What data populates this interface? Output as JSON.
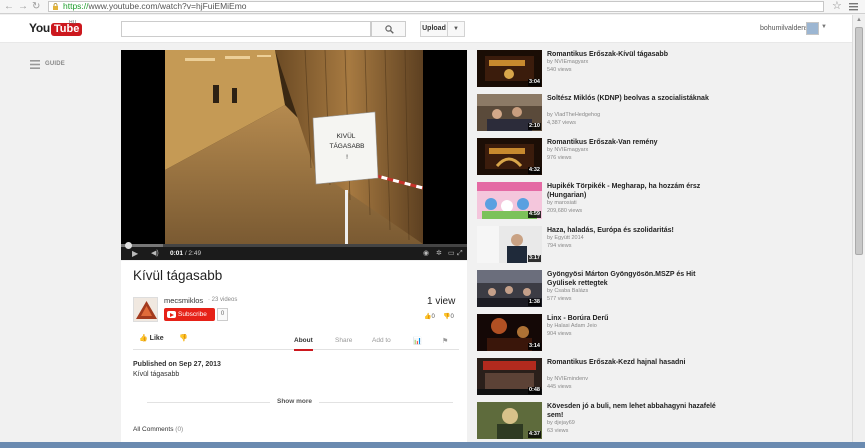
{
  "browser": {
    "url_scheme": "https://",
    "url_rest": "www.youtube.com/watch?v=hjFuiEMiEmo"
  },
  "header": {
    "logo_you": "You",
    "logo_tube": "Tube",
    "logo_cc": "HU",
    "upload_label": "Upload",
    "username": "bohumilvaldens"
  },
  "guide": {
    "label": "GUIDE"
  },
  "player": {
    "time_current": "0:01",
    "time_total": " / 2:49",
    "progress_fraction": 0.004,
    "sign_text": "KIVÜL\nTÁGASABB\n!"
  },
  "video": {
    "title": "Kívül tágasabb",
    "channel": "mecsmiklos",
    "video_count": "· 23 videos",
    "subscribe_label": "Subscribe",
    "subscriber_count": "0",
    "views": "1 view",
    "likes": "0",
    "dislikes": "0",
    "like_label": "Like",
    "tabs": [
      "About",
      "Share",
      "Add to"
    ],
    "published": "Published on Sep 27, 2013",
    "description": "Kívül tágasabb",
    "show_more": "Show more",
    "comments_label": "All Comments",
    "comments_count": "(0)"
  },
  "related": [
    {
      "title": "Romantikus Erőszak-Kívül tágasabb",
      "by": "by NVIEmagyarx",
      "views": "540 views",
      "duration": "3:04"
    },
    {
      "title": "Soltész Miklós (KDNP) beolvas a szocialistáknak",
      "by": "by VladTheHedgehog",
      "views": "4,387 views",
      "duration": "2:10"
    },
    {
      "title": "Romantikus Erőszak-Van remény",
      "by": "by NVIEmagyarx",
      "views": "976 views",
      "duration": "4:32"
    },
    {
      "title": "Hupikék Törpikék - Megharap, ha hozzám érsz (Hungarian)",
      "by": "by marosiati",
      "views": "209,680 views",
      "duration": "4:59"
    },
    {
      "title": "Haza, haladás, Európa és szolidaritás!",
      "by": "by Együtt 2014",
      "views": "794 views",
      "duration": "3:17"
    },
    {
      "title": "Gyöngyösi Márton Gyöngyösön.MSZP és Hit Gyülisek rettegtek",
      "by": "by Csaba Balázs",
      "views": "577 views",
      "duration": "1:38"
    },
    {
      "title": "Linx - Borúra Derű",
      "by": "by Halasi Adam Jeio",
      "views": "904 views",
      "duration": "3:14"
    },
    {
      "title": "Romantikus Erőszak-Kezd hajnal hasadni",
      "by": "by NVIEmindenv",
      "views": "445 views",
      "duration": "0:48"
    },
    {
      "title": "Kövesden jó a buli, nem lehet abbahagyni hazafelé sem!",
      "by": "by djejay69",
      "views": "63 views",
      "duration": "4:37"
    }
  ]
}
